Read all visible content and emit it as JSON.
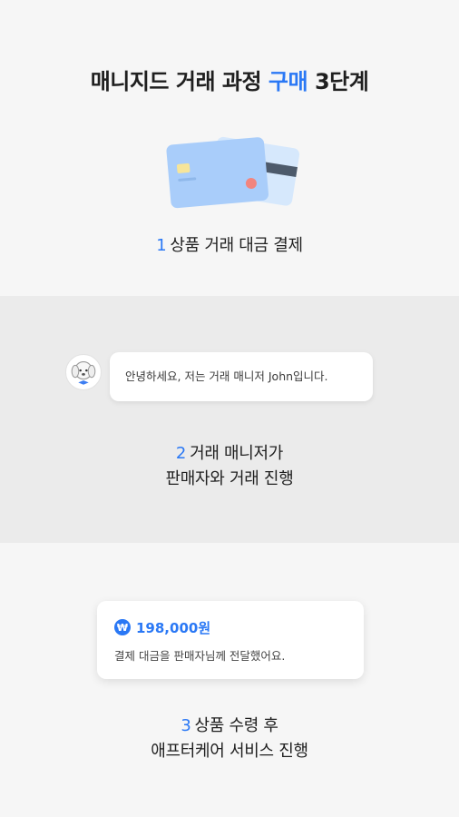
{
  "title": {
    "prefix": "매니지드 거래 과정",
    "highlight": "구매",
    "suffix": "3단계"
  },
  "steps": [
    {
      "number": "1",
      "line1": "상품 거래 대금 결제",
      "line2": ""
    },
    {
      "number": "2",
      "line1": "거래 매니저가",
      "line2": "판매자와 거래 진행"
    },
    {
      "number": "3",
      "line1": "상품 수령 후",
      "line2": "애프터케어 서비스 진행"
    }
  ],
  "chat": {
    "message": "안녕하세요, 저는 거래 매니저 John입니다."
  },
  "payment": {
    "currency_symbol": "₩",
    "amount": "198,000원",
    "message": "결제 대금을 판매자님께 전달했어요."
  },
  "colors": {
    "accent": "#2a78f5",
    "band": "#ebebeb",
    "background": "#f6f6f6",
    "card": "#aed2fb"
  },
  "icons": {
    "card": "credit-card-icon",
    "avatar": "dog-avatar-icon",
    "won": "won-coin-icon"
  }
}
